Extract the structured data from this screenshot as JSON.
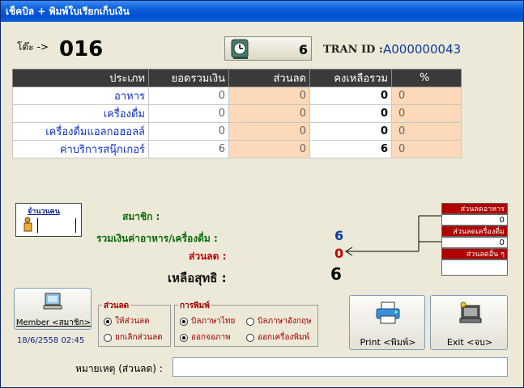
{
  "window": {
    "title": "เช็คบิล + พิมพ์ใบเรียกเก็บเงิน"
  },
  "header": {
    "table_label": "โต๊ะ ->",
    "table_number": "016",
    "guest_count": "6",
    "tran_label": "TRAN ID :",
    "tran_id": "A000000043"
  },
  "grid": {
    "columns": [
      "ประเภท",
      "ยอดรวมเงิน",
      "ส่วนลด",
      "คงเหลือรวม",
      "%"
    ],
    "rows": [
      [
        "อาหาร",
        "0",
        "0",
        "0",
        "0"
      ],
      [
        "เครื่องดื่ม",
        "0",
        "0",
        "0",
        "0"
      ],
      [
        "เครื่องดื่มแอลกอฮอลล์",
        "0",
        "0",
        "0",
        "0"
      ],
      [
        "ค่าบริการสนุ๊กเกอร์",
        "6",
        "0",
        "6",
        "0"
      ]
    ]
  },
  "guests": {
    "label": "จำนวนคน",
    "value": ""
  },
  "summary": {
    "member_label": "สมาชิก :",
    "total_label": "รวมเงินค่าอาหาร/เครื่องดื่ม :",
    "total_value": "6",
    "discount_label": "ส่วนลด :",
    "discount_value": "0",
    "net_label": "เหลือสุทธิ :",
    "net_value": "6"
  },
  "discount_panel": {
    "food_label": "ส่วนลดอาหาร",
    "food_value": "0",
    "drink_label": "ส่วนลดเครื่องดื่ม",
    "drink_value": "0",
    "other_label": "ส่วนลดอื่น ๆ",
    "other_value": ""
  },
  "member_button": {
    "label": "Member <สมาชิก>",
    "datetime": "18/6/2558  02:45"
  },
  "discount_group": {
    "title": "ส่วนลด",
    "options": [
      "ให้ส่วนลด",
      "ยกเลิกส่วนลด"
    ]
  },
  "print_group": {
    "title": "การพิมพ์",
    "lang_options": [
      "บิลภาษาไทย",
      "บิลภาษาอังกฤษ"
    ],
    "output_options": [
      "ออกจอภาพ",
      "ออกเครื่องพิมพ์"
    ]
  },
  "buttons": {
    "print": "Print <พิมพ์>",
    "exit": "Exit <จบ>"
  },
  "remark": {
    "label": "หมายเหตุ (ส่วนลด) :",
    "value": ""
  },
  "colors": {
    "accent_red": "#b00000",
    "discount_cell": "#fcd9b8",
    "total_blue": "#0b3aa0"
  }
}
